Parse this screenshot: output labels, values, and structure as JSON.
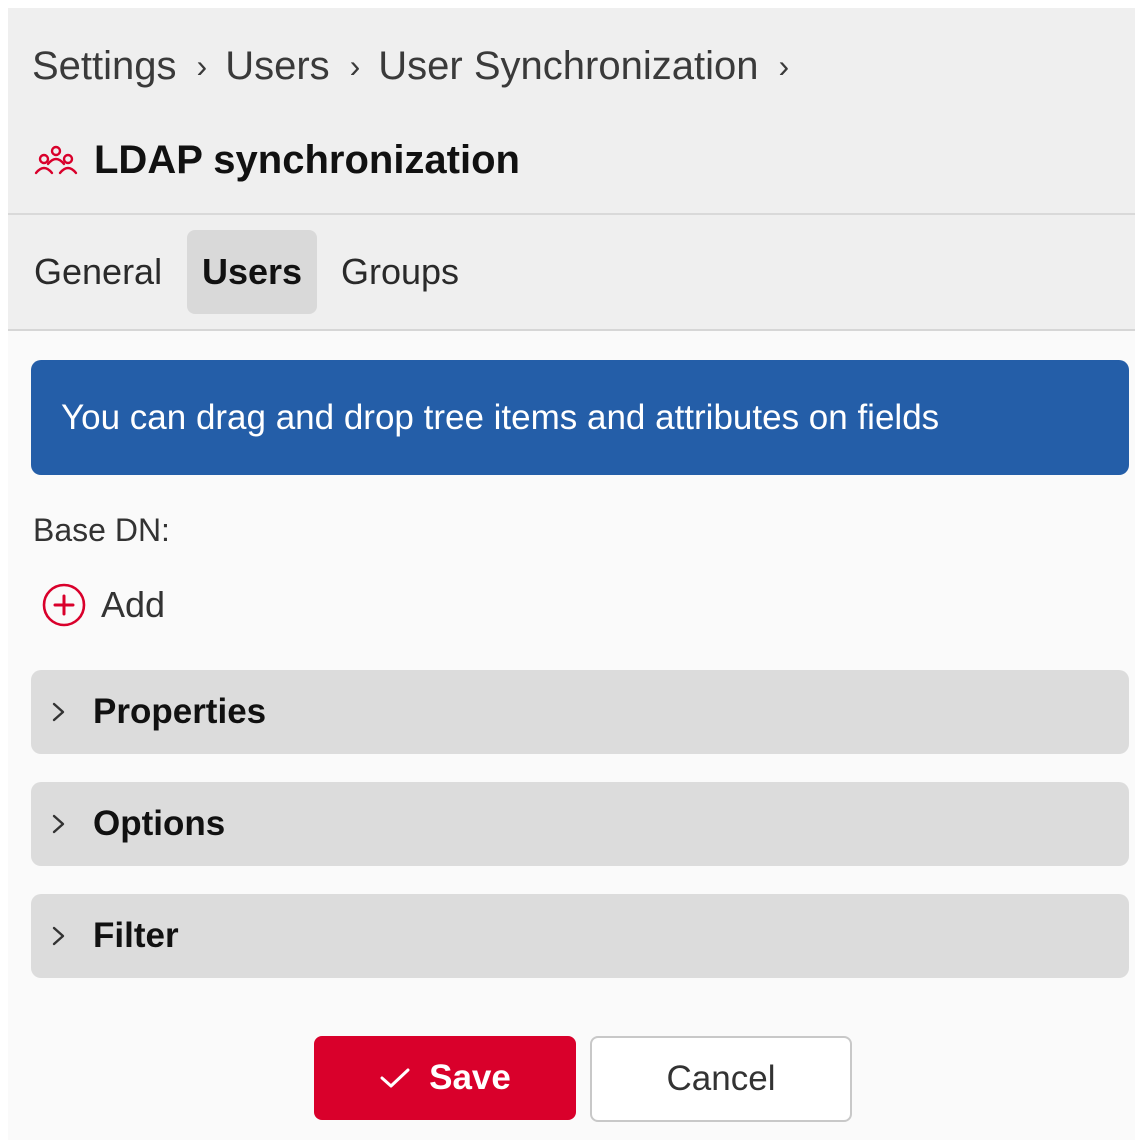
{
  "breadcrumb": {
    "items": [
      "Settings",
      "Users",
      "User Synchronization"
    ],
    "separator": "›"
  },
  "page": {
    "title": "LDAP synchronization",
    "title_icon": "users-group-icon"
  },
  "tabs": [
    {
      "label": "General",
      "active": false
    },
    {
      "label": "Users",
      "active": true
    },
    {
      "label": "Groups",
      "active": false
    }
  ],
  "info_banner": {
    "text": "You can drag and drop tree items and attributes on fields"
  },
  "base_dn": {
    "label": "Base DN:",
    "add_label": "Add",
    "add_icon": "plus-circle-icon"
  },
  "sections": [
    {
      "label": "Properties",
      "icon": "chevron-right-icon"
    },
    {
      "label": "Options",
      "icon": "chevron-right-icon"
    },
    {
      "label": "Filter",
      "icon": "chevron-right-icon"
    }
  ],
  "actions": {
    "save_label": "Save",
    "cancel_label": "Cancel",
    "save_icon": "check-icon"
  },
  "colors": {
    "accent_red": "#d9002b",
    "banner_blue": "#245ea8",
    "header_bg": "#efefef",
    "section_bg": "#dcdcdc"
  }
}
